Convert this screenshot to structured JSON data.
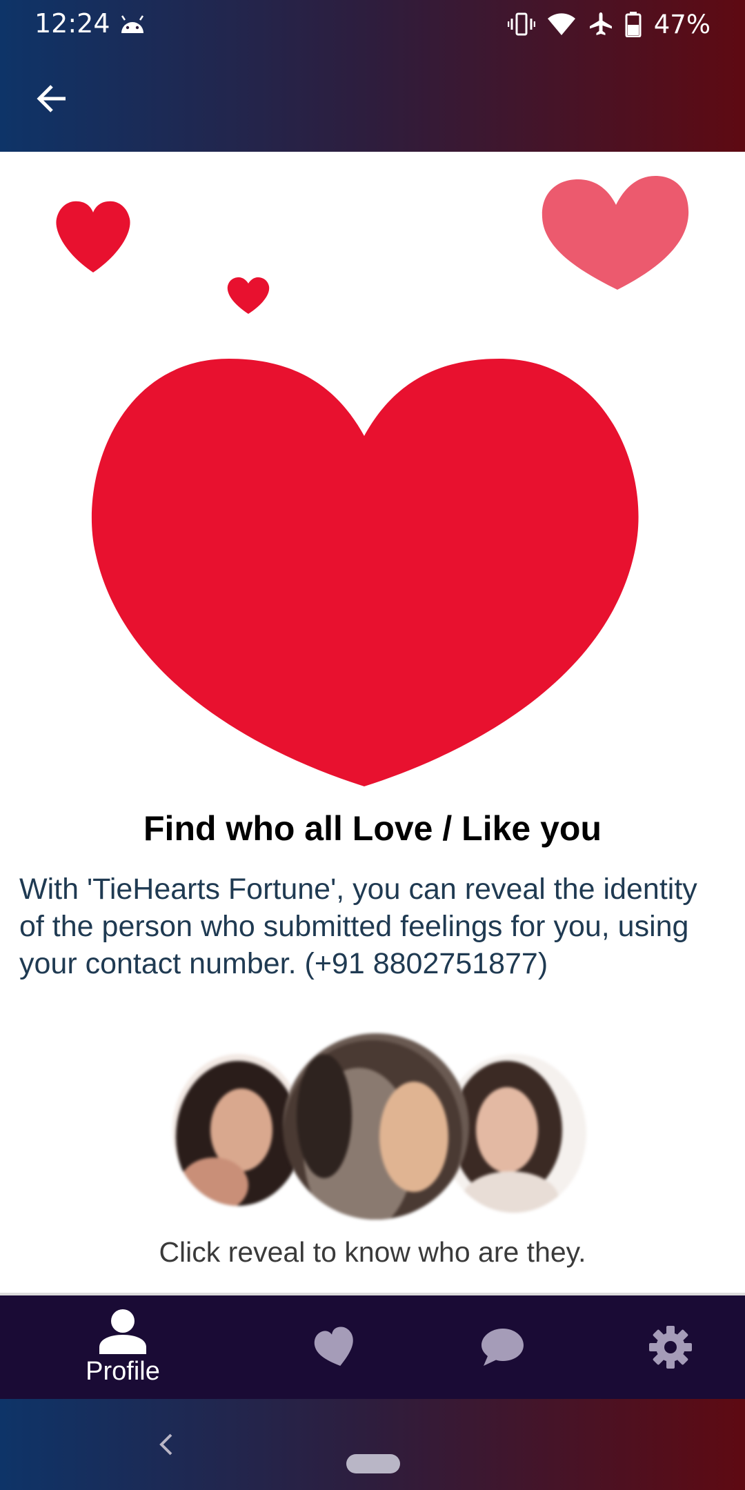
{
  "status_bar": {
    "time": "12:24",
    "battery_percent": "47%",
    "icons": [
      "android-icon",
      "vibrate-icon",
      "wifi-icon",
      "airplane-icon",
      "battery-icon"
    ]
  },
  "app_bar": {
    "back_icon": "arrow-left-icon"
  },
  "content": {
    "headline": "Find who all Love / Like you",
    "description": "With 'TieHearts Fortune', you can reveal the identity of the person who submitted feelings for you, using your contact number. (+91 8802751877)",
    "hint": "Click reveal to know who are they."
  },
  "bottom_nav": {
    "items": [
      {
        "icon": "person-icon",
        "label": "Profile",
        "active": true
      },
      {
        "icon": "heart-icon",
        "label": "",
        "active": false
      },
      {
        "icon": "chat-icon",
        "label": "",
        "active": false
      },
      {
        "icon": "gear-icon",
        "label": "",
        "active": false
      }
    ]
  },
  "colors": {
    "heart_red": "#e8112f",
    "heart_pink": "#ec5a6e",
    "nav_bg": "#1a0b35",
    "nav_inactive": "#a59cb8"
  }
}
